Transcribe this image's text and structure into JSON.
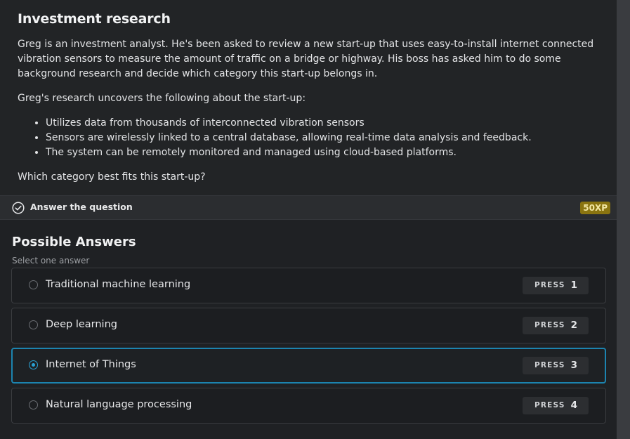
{
  "instructions": {
    "title": "Investment research",
    "paragraph1": "Greg is an investment analyst. He's been asked to review a new start-up that uses easy-to-install internet connected vibration sensors to measure the amount of traffic on a bridge or highway. His boss has asked him to do some background research and decide which category this start-up belongs in.",
    "paragraph2": "Greg's research uncovers the following about the start-up:",
    "bullets": [
      "Utilizes data from thousands of interconnected vibration sensors",
      "Sensors are wirelessly linked to a central database, allowing real-time data analysis and feedback.",
      "The system can be remotely monitored and managed using cloud-based platforms."
    ],
    "question": "Which category best fits this start-up?"
  },
  "task": {
    "label": "Answer the question",
    "xp": "50XP",
    "icon": "check-circle-icon"
  },
  "answers": {
    "title": "Possible Answers",
    "hint": "Select one answer",
    "press_word": "PRESS",
    "selected_index": 2,
    "options": [
      {
        "label": "Traditional machine learning",
        "key": "1"
      },
      {
        "label": "Deep learning",
        "key": "2"
      },
      {
        "label": "Internet of Things",
        "key": "3"
      },
      {
        "label": "Natural language processing",
        "key": "4"
      }
    ]
  },
  "colors": {
    "accent": "#1c84b0",
    "xp_badge": "#8a7410"
  }
}
